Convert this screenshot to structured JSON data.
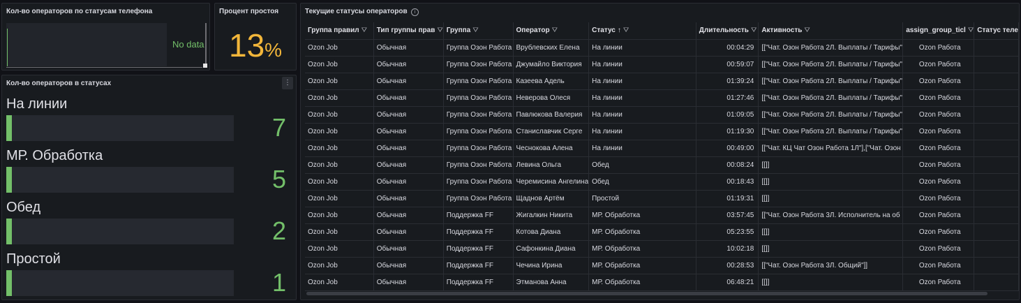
{
  "panel_phone": {
    "title": "Кол-во операторов по статусам телефона",
    "nodata": "No data"
  },
  "panel_idle": {
    "title": "Процент простоя",
    "value": "13",
    "unit": "%"
  },
  "panel_statuses": {
    "title": "Кол-во операторов в статусах",
    "menu_icon": "⋮",
    "max": 7,
    "items": [
      {
        "label": "На линии",
        "value": "7"
      },
      {
        "label": "МР. Обработка",
        "value": "5"
      },
      {
        "label": "Обед",
        "value": "2"
      },
      {
        "label": "Простой",
        "value": "1"
      }
    ]
  },
  "panel_table": {
    "title": "Текущие статусы операторов",
    "info_icon": "i",
    "filter_icon": "⛛",
    "sort_icon": "↑",
    "columns": [
      "Группа правил",
      "Тип группы прав",
      "Группа",
      "Оператор",
      "Статус",
      "Длительность",
      "Активность",
      "assign_group_ticl",
      "Статус теле"
    ],
    "rows": [
      [
        "Ozon Job",
        "Обычная",
        "Группа Озон Работа",
        "Врублевских Елена",
        "На линии",
        "00:04:29",
        "[[\"Чат. Озон Работа 2Л. Выплаты / Тарифы\"",
        "Ozon Работа",
        ""
      ],
      [
        "Ozon Job",
        "Обычная",
        "Группа Озон Работа",
        "Джумайло Виктория",
        "На линии",
        "00:59:07",
        "[[\"Чат. Озон Работа 2Л. Выплаты / Тарифы\"",
        "Ozon Работа",
        ""
      ],
      [
        "Ozon Job",
        "Обычная",
        "Группа Озон Работа",
        "Казеева Адель",
        "На линии",
        "01:39:24",
        "[[\"Чат. Озон Работа 2Л. Выплаты / Тарифы\"",
        "Ozon Работа",
        ""
      ],
      [
        "Ozon Job",
        "Обычная",
        "Группа Озон Работа",
        "Неверова Олеся",
        "На линии",
        "01:27:46",
        "[[\"Чат. Озон Работа 2Л. Выплаты / Тарифы\"",
        "Ozon Работа",
        ""
      ],
      [
        "Ozon Job",
        "Обычная",
        "Группа Озон Работа",
        "Павлюкова Валерия",
        "На линии",
        "01:09:05",
        "[[\"Чат. Озон Работа 2Л. Выплаты / Тарифы\"",
        "Ozon Работа",
        ""
      ],
      [
        "Ozon Job",
        "Обычная",
        "Группа Озон Работа",
        "Станиславчик Серге",
        "На линии",
        "01:19:30",
        "[[\"Чат. Озон Работа 2Л. Выплаты / Тарифы\"",
        "Ozon Работа",
        ""
      ],
      [
        "Ozon Job",
        "Обычная",
        "Группа Озон Работа",
        "Чеснокова Алена",
        "На линии",
        "00:49:00",
        "[[\"Чат. КЦ Чат Озон Работа 1Л\"],[\"Чат. Озон",
        "Ozon Работа",
        ""
      ],
      [
        "Ozon Job",
        "Обычная",
        "Группа Озон Работа",
        "Левина Ольга",
        "Обед",
        "00:08:24",
        "[[]]",
        "Ozon Работа",
        ""
      ],
      [
        "Ozon Job",
        "Обычная",
        "Группа Озон Работа",
        "Черемисина Ангелина",
        "Обед",
        "00:18:43",
        "[[]]",
        "Ozon Работа",
        ""
      ],
      [
        "Ozon Job",
        "Обычная",
        "Группа Озон Работа",
        "Щаднов Артём",
        "Простой",
        "01:19:31",
        "[[]]",
        "Ozon Работа",
        ""
      ],
      [
        "Ozon Job",
        "Обычная",
        "Поддержка FF",
        "Жигалкин Никита",
        "МР. Обработка",
        "03:57:45",
        "[[\"Чат. Озон Работа 3Л. Исполнитель на об",
        "Ozon Работа",
        ""
      ],
      [
        "Ozon Job",
        "Обычная",
        "Поддержка FF",
        "Котова Диана",
        "МР. Обработка",
        "05:23:55",
        "[[]]",
        "Ozon Работа",
        ""
      ],
      [
        "Ozon Job",
        "Обычная",
        "Поддержка FF",
        "Сафонкина Диана",
        "МР. Обработка",
        "10:02:18",
        "[[]]",
        "Ozon Работа",
        ""
      ],
      [
        "Ozon Job",
        "Обычная",
        "Поддержка FF",
        "Чечина Ирина",
        "МР. Обработка",
        "00:28:53",
        "[[\"Чат. Озон Работа 3Л. Общий\"]]",
        "Ozon Работа",
        ""
      ],
      [
        "Ozon Job",
        "Обычная",
        "Поддержка FF",
        "Этманова Анна",
        "МР. Обработка",
        "06:48:21",
        "[[]]",
        "Ozon Работа",
        ""
      ]
    ]
  },
  "colors": {
    "accent_green": "#73bf69",
    "accent_orange": "#f2b63a",
    "panel_bg": "#181b1f",
    "page_bg": "#111217"
  }
}
